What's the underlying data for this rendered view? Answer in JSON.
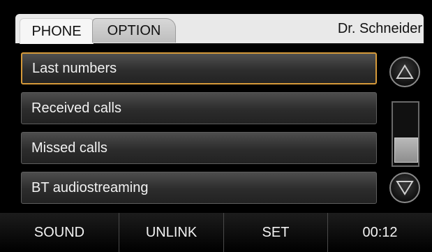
{
  "header": {
    "tabs": [
      {
        "label": "PHONE"
      },
      {
        "label": "OPTION"
      }
    ],
    "user_name": "Dr. Schneider"
  },
  "menu": {
    "items": [
      {
        "label": "Last numbers"
      },
      {
        "label": "Received calls"
      },
      {
        "label": "Missed calls"
      },
      {
        "label": "BT audiostreaming"
      }
    ]
  },
  "footer": {
    "buttons": [
      {
        "label": "SOUND"
      },
      {
        "label": "UNLINK"
      },
      {
        "label": "SET"
      }
    ],
    "clock": "00:12"
  },
  "icons": {
    "scroll_up": "triangle-up-icon",
    "scroll_down": "triangle-down-icon"
  },
  "colors": {
    "selection_border": "#d69a3a",
    "background": "#000000",
    "header": "#e9e9e9"
  }
}
